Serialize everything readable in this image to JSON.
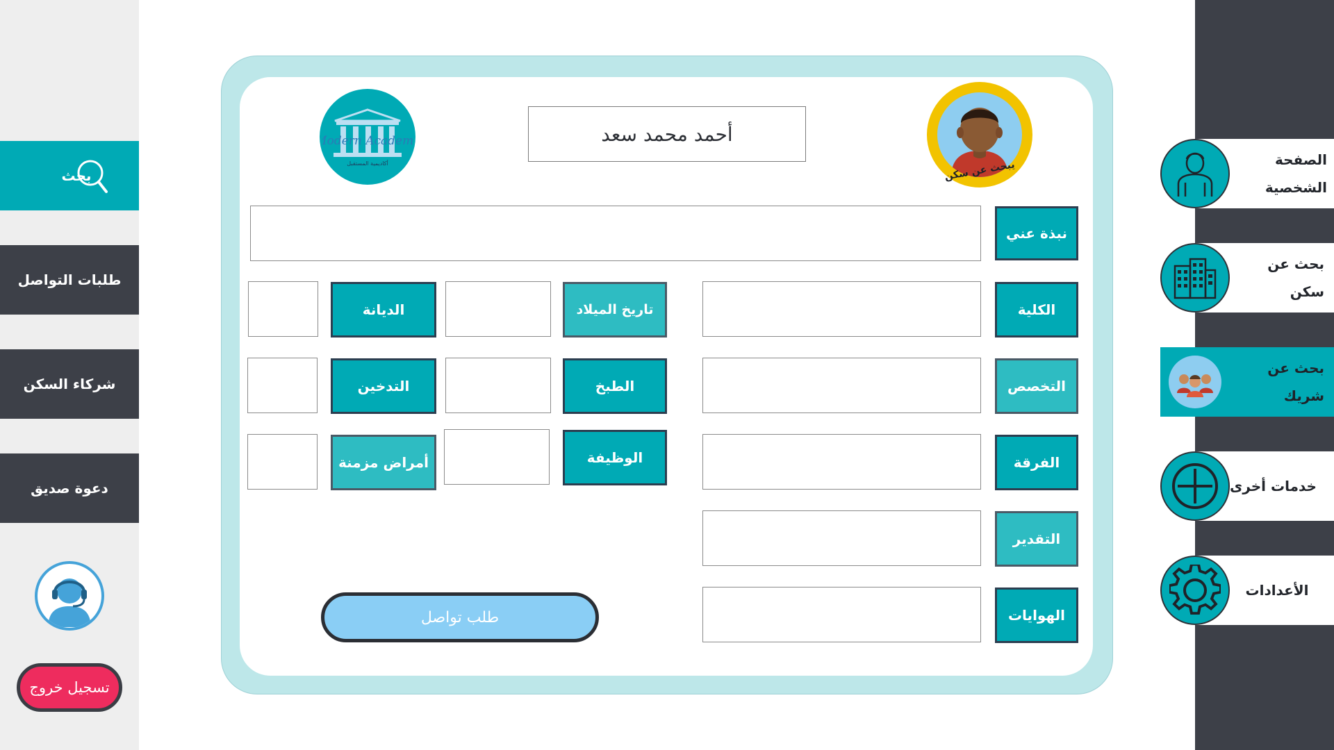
{
  "profile": {
    "name": "أحمد محمد سعد",
    "avatar_caption": "يبحث عن سكن"
  },
  "left_nav": {
    "search_label": "بحث",
    "items": [
      {
        "label": "طلبات التواصل"
      },
      {
        "label": "شركاء السكن"
      },
      {
        "label": "دعوة صديق"
      }
    ],
    "logout_label": "تسجيل خروج"
  },
  "right_nav": {
    "items": [
      {
        "label": "الصفحة الشخصية",
        "icon": "person-icon"
      },
      {
        "label": "بحث عن سكن",
        "icon": "building-icon"
      },
      {
        "label": "بحث عن شريك",
        "icon": "people-icon"
      },
      {
        "label": "خدمات أخرى",
        "icon": "plus-circle-icon"
      },
      {
        "label": "الأعدادات",
        "icon": "gear-icon"
      }
    ]
  },
  "logo": {
    "text": "Modern Academy",
    "subtitle": "أكاديمية المستقبل"
  },
  "form": {
    "bio_label": "نبذة عني",
    "left_labels": [
      "الكلية",
      "التخصص",
      "الفرقة",
      "التقدير",
      "الهوايات"
    ],
    "middle_labels": [
      "تاريخ الميلاد",
      "الطبخ",
      "الوظيفة"
    ],
    "right_labels": [
      "الديانة",
      "التدخين",
      "أمراض مزمنة"
    ]
  },
  "contact_button_label": "طلب تواصل",
  "colors": {
    "accent": "#00aab5",
    "dark": "#3d4048",
    "card_border": "#bde7e9",
    "logout": "#ee2c5e",
    "contact": "#8acef5"
  }
}
